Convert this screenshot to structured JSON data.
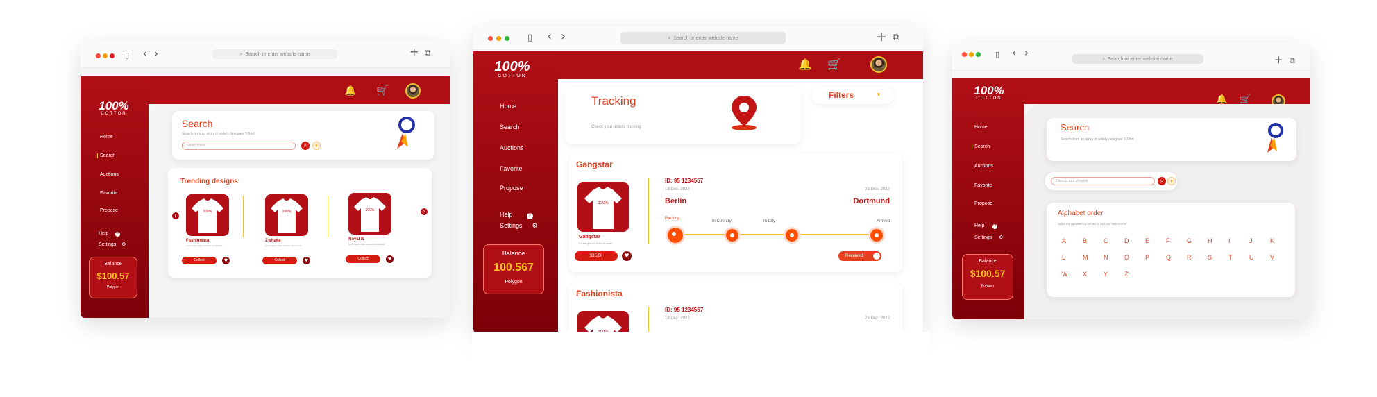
{
  "browser": {
    "url_placeholder": "Search or enter website name",
    "url_search_icon": "search-icon",
    "back_icon": "‹",
    "forward_icon": "›",
    "new_tab_icon": "+",
    "tabs_icon": "⧉",
    "sidebar_icon": "▯"
  },
  "brand": {
    "logo_main": "100%",
    "logo_sub": "COTTON"
  },
  "nav": {
    "home": "Home",
    "search": "Search",
    "auctions": "Auctions",
    "favorite": "Favorite",
    "propose": "Propose",
    "help": "Help",
    "settings": "Settings"
  },
  "icons": {
    "bell": "🔔",
    "cart": "🛒",
    "heart": "♥",
    "gear": "⚙",
    "question": "?",
    "filter": "▼",
    "search": "⌕",
    "chevron_left": "‹",
    "chevron_right": "›"
  },
  "colors": {
    "brand_red": "#ad0f15",
    "accent_orange": "#e2401e",
    "balance_yellow": "#ffc21a"
  },
  "screen1": {
    "search_title": "Search",
    "search_sub": "Search from an array of widely designed T-Shirt",
    "search_placeholder": "Search here",
    "trending_title": "Trending designs",
    "products": [
      {
        "name": "Fashionista",
        "desc": "Lorem ipsum dolor sit amet consectetur",
        "button": "Collect"
      },
      {
        "name": "Z-shake",
        "desc": "Lorem ipsum dolor sit amet consectetur",
        "button": "Collect"
      },
      {
        "name": "Royal B",
        "desc": "Lorem ipsum dolor sit amet consectetur",
        "button": "Collect"
      }
    ],
    "balance_label": "Balance",
    "balance_value": "$100.57",
    "balance_currency": "Polygon"
  },
  "screen2": {
    "tracking_title": "Tracking",
    "tracking_sub": "Check your orders tracking",
    "filters_label": "Filters",
    "balance_label": "Balance",
    "balance_value": "100.567",
    "balance_currency": "Polygon",
    "orders": [
      {
        "brand": "Gangstar",
        "id": "ID: 95 1234567",
        "date_from": "18 Dec. 2022",
        "date_to": "21 Dec. 2022",
        "from": "Berlin",
        "to": "Dortmund",
        "product_name": "Gangstar",
        "product_desc": "Lorem ipsum dolor sit amet",
        "price": "$35.00",
        "steps": [
          "Packing",
          "In Country",
          "In City",
          "Arrived"
        ],
        "status_button": "Received",
        "progress_fraction": 1.0
      },
      {
        "brand": "Fashionista",
        "id": "ID: 95 1234567",
        "date_from": "18 Dec. 2022",
        "date_to": "21 Dec. 2022"
      }
    ]
  },
  "screen3": {
    "search_title": "Search",
    "search_sub": "Search from an array of widely designed T-Shirt",
    "search_placeholder": "2 words and phrases",
    "alphabet_title": "Alphabet order",
    "alphabet_sub": "Select the alphabet you will like to sort your search from",
    "letters": [
      "A",
      "B",
      "C",
      "D",
      "E",
      "F",
      "G",
      "H",
      "I",
      "J",
      "K",
      "L",
      "M",
      "N",
      "O",
      "P",
      "Q",
      "R",
      "S",
      "T",
      "U",
      "V",
      "W",
      "X",
      "Y",
      "Z"
    ],
    "balance_label": "Balance",
    "balance_value": "$100.57",
    "balance_currency": "Polygon"
  }
}
